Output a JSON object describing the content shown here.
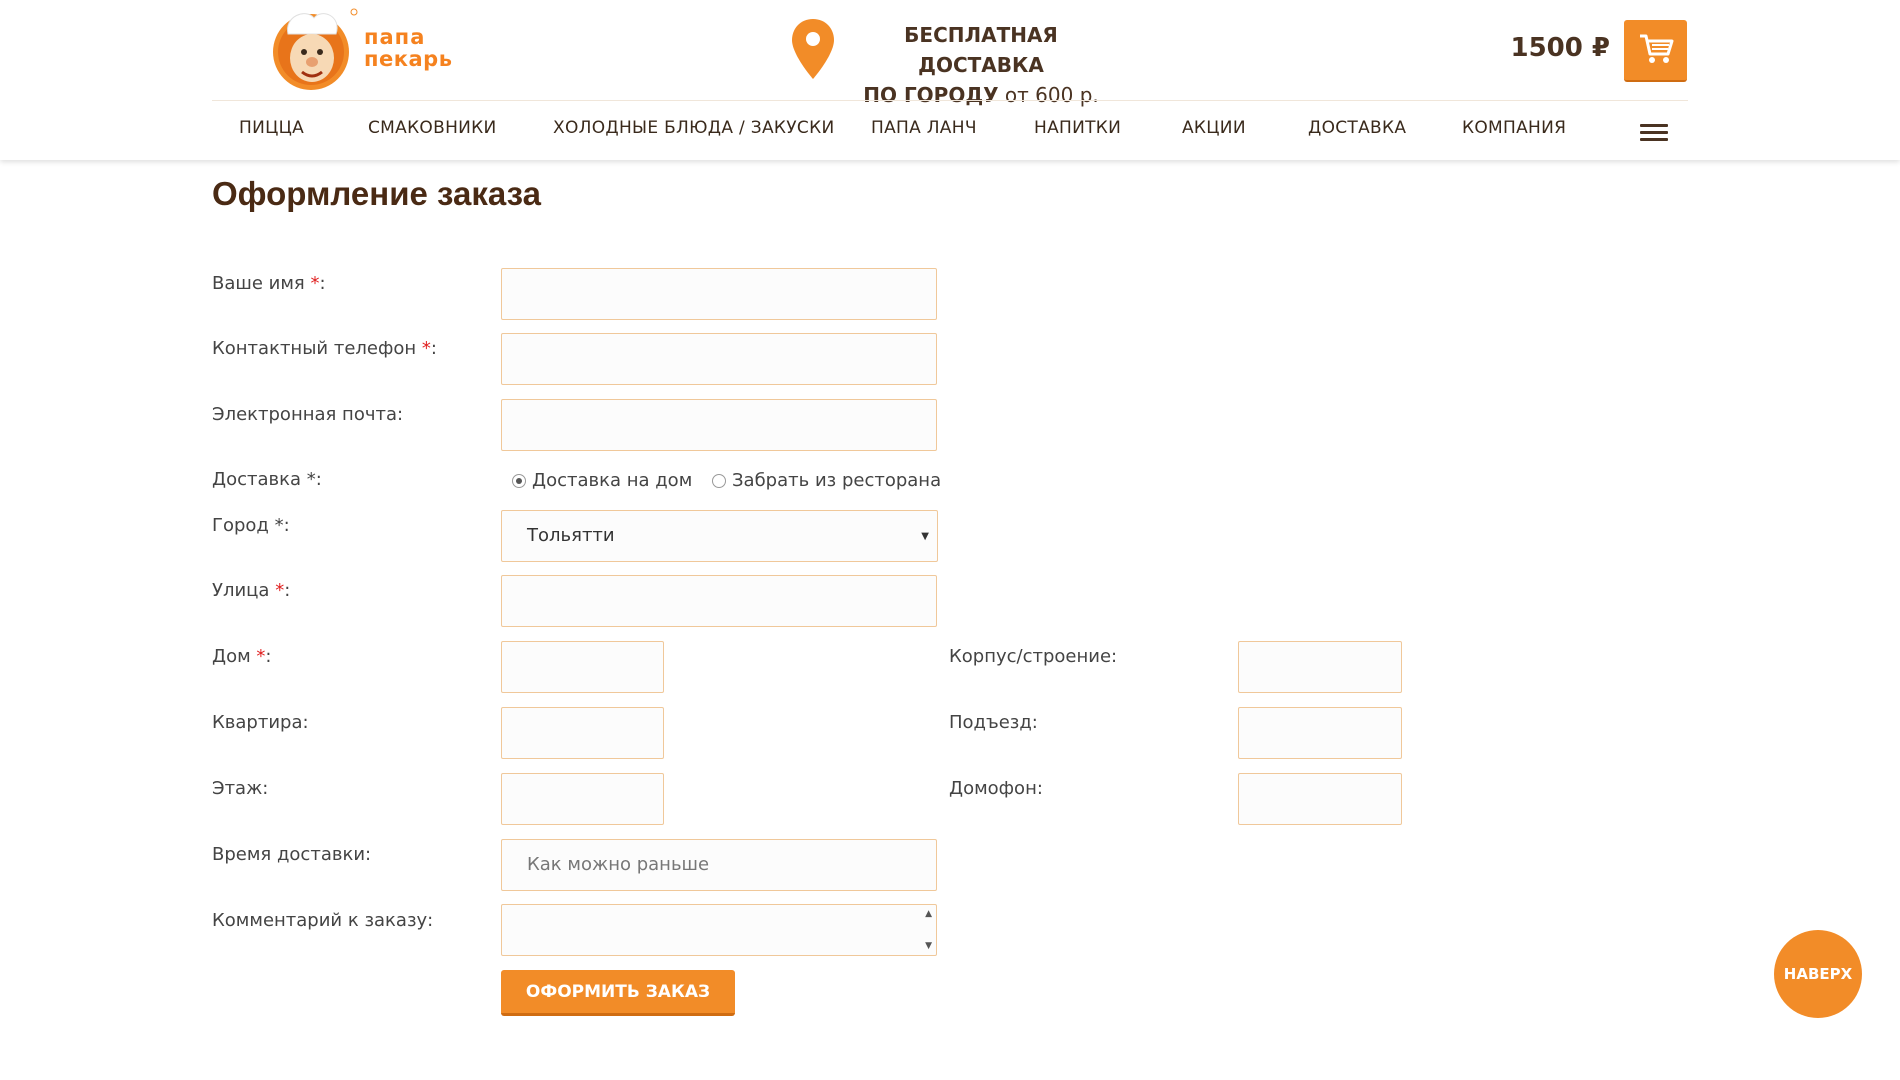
{
  "brand": {
    "line1": "папа",
    "line2": "пекарь"
  },
  "header": {
    "delivery_line1": "БЕСПЛАТНАЯ ДОСТАВКА",
    "delivery_line2_bold": "ПО ГОРОДУ",
    "delivery_line2_rest": " от 600 р.",
    "cart_total": "1500 ₽"
  },
  "nav": [
    "ПИЦЦА",
    "СМАКОВНИКИ",
    "ХОЛОДНЫЕ БЛЮДА / ЗАКУСКИ",
    "ПАПА ЛАНЧ",
    "НАПИТКИ",
    "АКЦИИ",
    "ДОСТАВКА",
    "КОМПАНИЯ"
  ],
  "page_title": "Оформление заказа",
  "form": {
    "name_label": "Ваше имя ",
    "phone_label": "Контактный телефон ",
    "email_label": "Электронная почта:",
    "delivery_label": "Доставка *:",
    "delivery_options": [
      "Доставка на дом",
      "Забрать из ресторана"
    ],
    "city_label": "Город *:",
    "city_value": "Тольятти",
    "street_label": "Улица ",
    "house_label": "Дом ",
    "building_label": "Корпус/строение:",
    "apartment_label": "Квартира:",
    "entrance_label": "Подъезд:",
    "floor_label": "Этаж:",
    "intercom_label": "Домофон:",
    "time_label": "Время доставки:",
    "time_placeholder": "Как можно раньше",
    "comment_label": "Комментарий к заказу:",
    "required_mark": "*",
    "colon": ":",
    "submit": "ОФОРМИТЬ ЗАКАЗ"
  },
  "to_top": "НАВЕРХ",
  "colors": {
    "accent": "#f28c28",
    "text_dark": "#4a2a14",
    "input_border": "#f0c89a"
  }
}
